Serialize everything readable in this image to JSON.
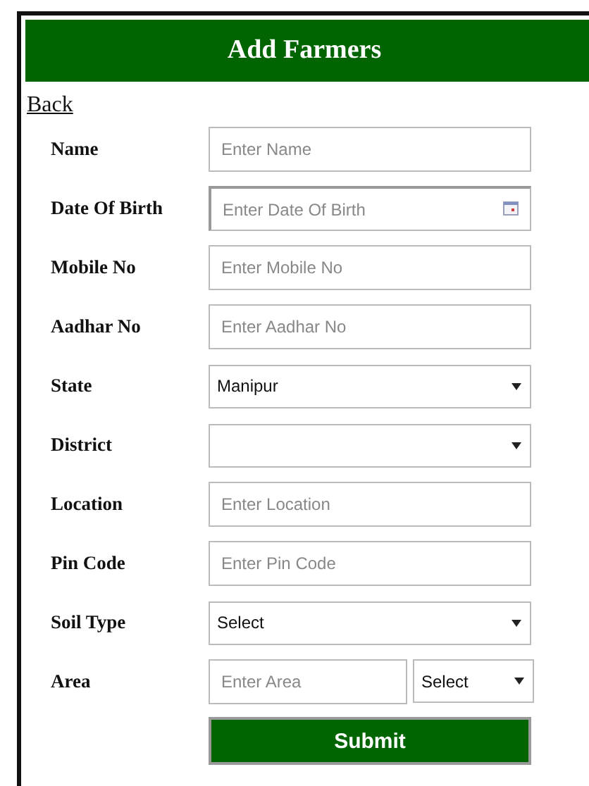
{
  "header": {
    "title": "Add Farmers"
  },
  "back_link": "Back",
  "fields": [
    {
      "kind": "input",
      "label": "Name",
      "placeholder": "Enter Name"
    },
    {
      "kind": "date",
      "label": "Date Of Birth",
      "placeholder": "Enter Date Of Birth"
    },
    {
      "kind": "input",
      "label": "Mobile No",
      "placeholder": "Enter Mobile No"
    },
    {
      "kind": "input",
      "label": "Aadhar No",
      "placeholder": "Enter Aadhar No"
    },
    {
      "kind": "select",
      "label": "State",
      "value": "Manipur"
    },
    {
      "kind": "select",
      "label": "District"
    },
    {
      "kind": "input",
      "label": "Location",
      "placeholder": "Enter Location"
    },
    {
      "kind": "input",
      "label": "Pin Code",
      "placeholder": "Enter Pin Code"
    },
    {
      "kind": "select",
      "label": "Soil Type",
      "value": "Select"
    },
    {
      "kind": "input_select",
      "label": "Area",
      "placeholder": "Enter Area",
      "value": "Select"
    }
  ],
  "submit_button": "Submit"
}
